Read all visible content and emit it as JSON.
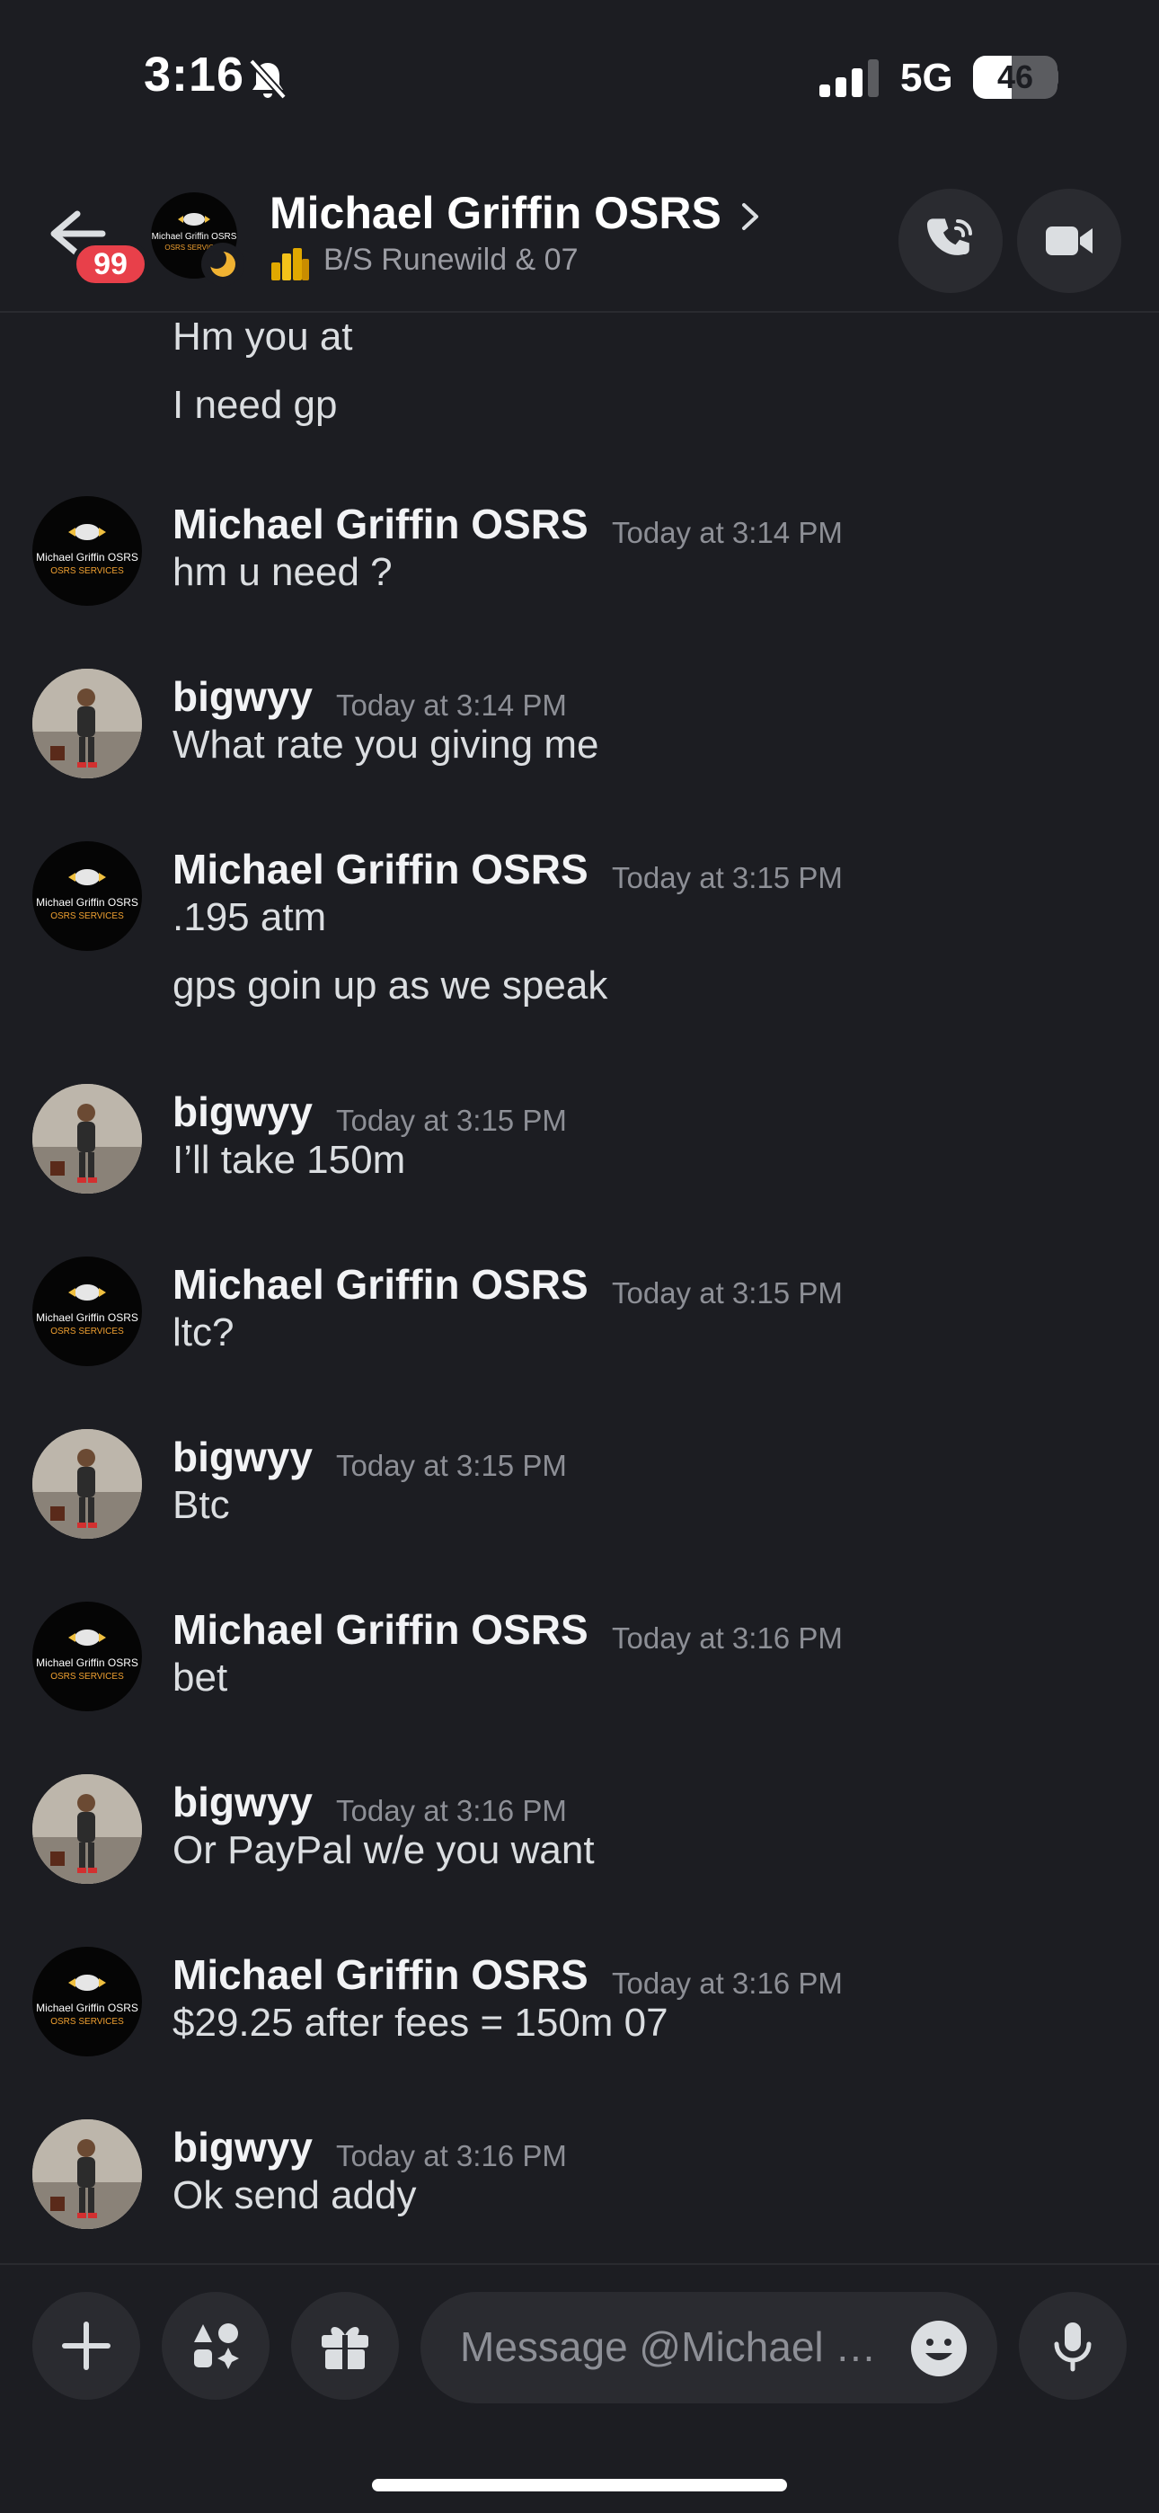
{
  "status_bar": {
    "time": "3:16",
    "network": "5G",
    "battery_level": "46",
    "battery_fraction": 0.46
  },
  "header": {
    "back_badge": "99",
    "title": "Michael Griffin OSRS",
    "subtitle": "B/S Runewild & 07",
    "chevron": "›",
    "avatar_text_line1": "Michael Griffin OSRS",
    "avatar_text_line2": "OSRS SERVICES",
    "accent_badge_color": "#e8404a"
  },
  "messages": {
    "continuations": [
      "Hm you at",
      "I need gp"
    ],
    "groups": [
      {
        "author": "Michael Griffin OSRS",
        "time": "Today at 3:14 PM",
        "lines": [
          "hm u need ?"
        ]
      },
      {
        "author": "bigwyy",
        "time": "Today at 3:14 PM",
        "lines": [
          "What rate you giving me"
        ]
      },
      {
        "author": "Michael Griffin OSRS",
        "time": "Today at 3:15 PM",
        "lines": [
          ".195 atm",
          "gps goin up as we speak"
        ]
      },
      {
        "author": "bigwyy",
        "time": "Today at 3:15 PM",
        "lines": [
          "I’ll take 150m"
        ]
      },
      {
        "author": "Michael Griffin OSRS",
        "time": "Today at 3:15 PM",
        "lines": [
          "ltc?"
        ]
      },
      {
        "author": "bigwyy",
        "time": "Today at 3:15 PM",
        "lines": [
          "Btc"
        ]
      },
      {
        "author": "Michael Griffin OSRS",
        "time": "Today at 3:16 PM",
        "lines": [
          "bet"
        ]
      },
      {
        "author": "bigwyy",
        "time": "Today at 3:16 PM",
        "lines": [
          "Or PayPal w/e you want"
        ]
      },
      {
        "author": "Michael Griffin OSRS",
        "time": "Today at 3:16 PM",
        "lines": [
          "$29.25 after fees = 150m 07"
        ]
      },
      {
        "author": "bigwyy",
        "time": "Today at 3:16 PM",
        "lines": [
          "Ok send addy"
        ]
      }
    ]
  },
  "composer": {
    "placeholder": "Message @Michael Gr..."
  },
  "icons": {
    "back": "arrow-left-icon",
    "call": "phone-call-icon",
    "video": "video-camera-icon",
    "add": "plus-icon",
    "apps": "apps-icon",
    "gift": "gift-icon",
    "emoji": "emoji-icon",
    "mic": "microphone-icon"
  }
}
